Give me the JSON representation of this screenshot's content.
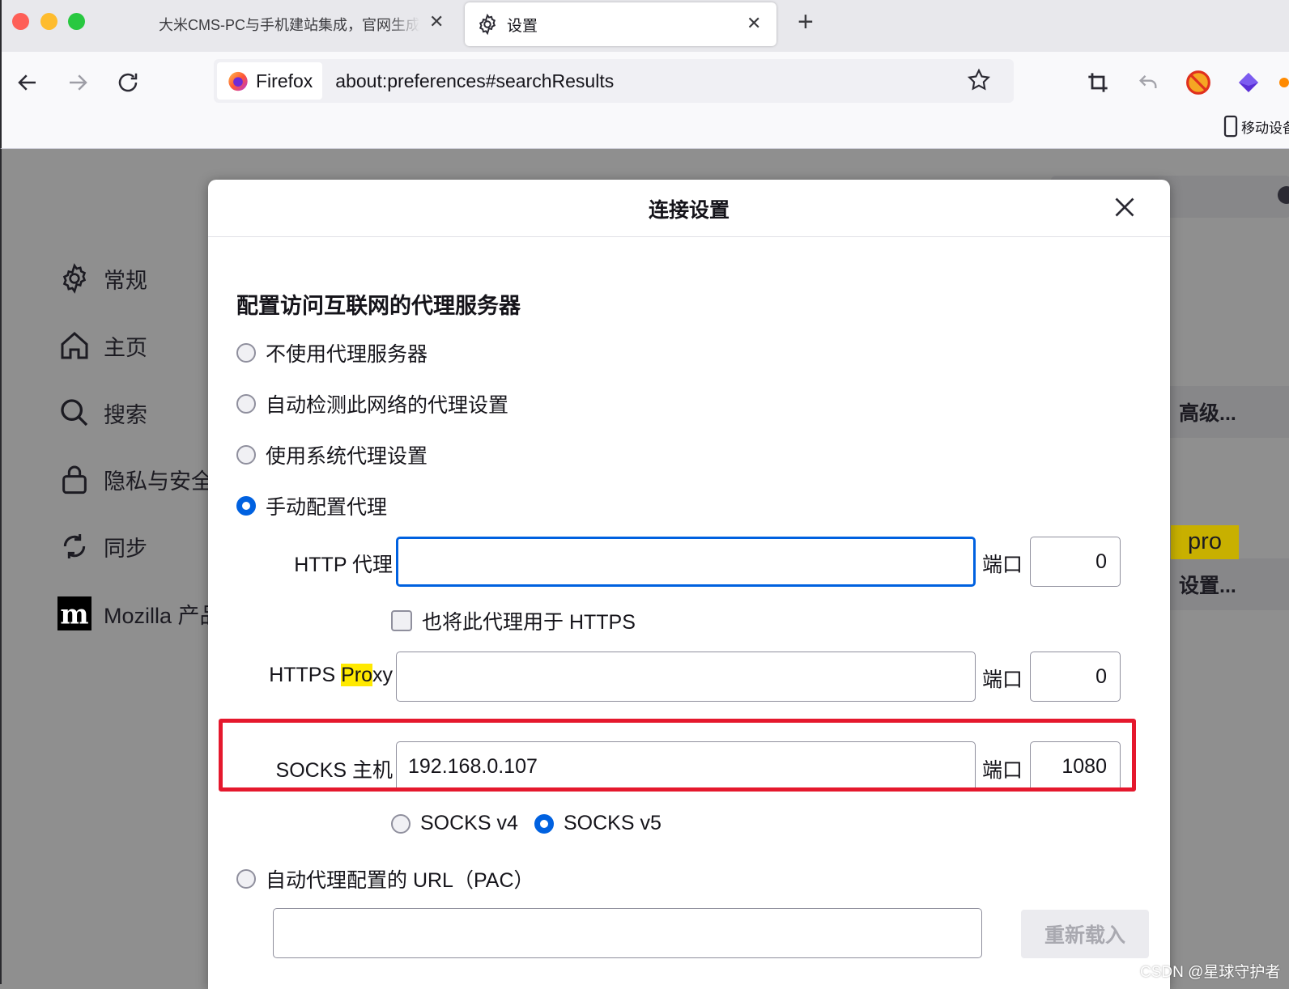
{
  "tabs": {
    "inactive_title": "大米CMS-PC与手机建站集成，官网生成",
    "active_title": "设置",
    "new_tab": "+"
  },
  "navbar": {
    "identity_label": "Firefox",
    "url": "about:preferences#searchResults",
    "mobile_bookmarks": "移动设备"
  },
  "sidebar": {
    "items": [
      {
        "label": "常规",
        "icon": "gear-icon"
      },
      {
        "label": "主页",
        "icon": "home-icon"
      },
      {
        "label": "搜索",
        "icon": "search-icon"
      },
      {
        "label": "隐私与安全",
        "icon": "lock-icon"
      },
      {
        "label": "同步",
        "icon": "sync-icon"
      },
      {
        "label": "Mozilla 产品",
        "icon": "mozilla-icon"
      }
    ]
  },
  "background": {
    "advanced_button": "高级...",
    "tooltip": "pro",
    "settings_button": "设置..."
  },
  "dialog": {
    "title": "连接设置",
    "section_heading": "配置访问互联网的代理服务器",
    "options": {
      "no_proxy": "不使用代理服务器",
      "auto_detect": "自动检测此网络的代理设置",
      "system_proxy": "使用系统代理设置",
      "manual_proxy": "手动配置代理",
      "pac_url": "自动代理配置的 URL（PAC）"
    },
    "selected_option": "manual_proxy",
    "http": {
      "label": "HTTP 代理",
      "value": "",
      "port_label": "端口",
      "port": "0"
    },
    "also_https": {
      "label": "也将此代理用于 HTTPS",
      "checked": false
    },
    "https": {
      "label_prefix": "HTTPS ",
      "label_highlight": "Pro",
      "label_suffix": "xy",
      "value": "",
      "port_label": "端口",
      "port": "0"
    },
    "socks": {
      "label": "SOCKS 主机",
      "value": "192.168.0.107",
      "port_label": "端口",
      "port": "1080"
    },
    "socks_versions": {
      "v4": "SOCKS v4",
      "v5": "SOCKS v5",
      "selected": "v5"
    },
    "pac_value": "",
    "reload_label": "重新载入"
  },
  "watermark": "CSDN @星球守护者",
  "colors": {
    "accent": "#0061e0",
    "annotation": "#e5182d",
    "highlight": "#ffe900"
  }
}
